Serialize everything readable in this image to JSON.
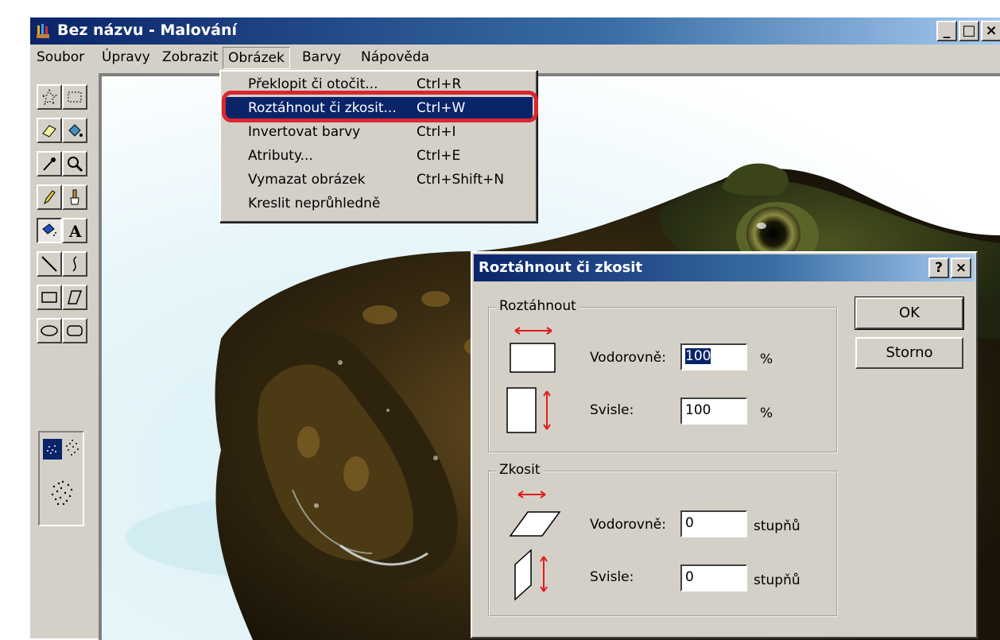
{
  "window": {
    "title": "Bez názvu - Malování",
    "controls": [
      "_",
      "□",
      "×"
    ]
  },
  "menubar": {
    "items": [
      "Soubor",
      "Úpravy",
      "Zobrazit",
      "Obrázek",
      "Barvy",
      "Nápověda"
    ],
    "open_item": "Obrázek"
  },
  "image_menu": {
    "items": [
      {
        "label": "Překlopit či otočit...",
        "shortcut": "Ctrl+R"
      },
      {
        "label": "Roztáhnout či zkosit...",
        "shortcut": "Ctrl+W"
      },
      {
        "label": "Invertovat barvy",
        "shortcut": "Ctrl+I"
      },
      {
        "label": "Atributy...",
        "shortcut": "Ctrl+E"
      },
      {
        "label": "Vymazat obrázek",
        "shortcut": "Ctrl+Shift+N"
      },
      {
        "label": "Kreslit neprůhledně",
        "shortcut": ""
      }
    ],
    "selected": "Roztáhnout či zkosit..."
  },
  "toolbox": {
    "tools": [
      "free-select",
      "rect-select",
      "eraser",
      "fill",
      "color-picker",
      "magnifier",
      "pencil",
      "brush",
      "airbrush",
      "text",
      "line",
      "curve",
      "rectangle",
      "polygon",
      "ellipse",
      "rounded-rectangle"
    ],
    "active_tool": "airbrush",
    "text_tool_glyph": "A"
  },
  "dialog": {
    "title": "Roztáhnout či zkosit",
    "help_label": "?",
    "close_label": "×",
    "stretch": {
      "group_label": "Roztáhnout",
      "horizontal_label": "Vodorovně:",
      "horizontal_value": "100",
      "horizontal_unit": "%",
      "vertical_label": "Svisle:",
      "vertical_value": "100",
      "vertical_unit": "%"
    },
    "skew": {
      "group_label": "Zkosit",
      "horizontal_label": "Vodorovně:",
      "horizontal_value": "0",
      "horizontal_unit": "stupňů",
      "vertical_label": "Svisle:",
      "vertical_value": "0",
      "vertical_unit": "stupňů"
    },
    "ok_label": "OK",
    "cancel_label": "Storno"
  },
  "colors": {
    "title_active": "#0a246a",
    "face": "#d4d0c8",
    "highlight_ring": "#d9262f",
    "arrow_red": "#e31b1b"
  }
}
